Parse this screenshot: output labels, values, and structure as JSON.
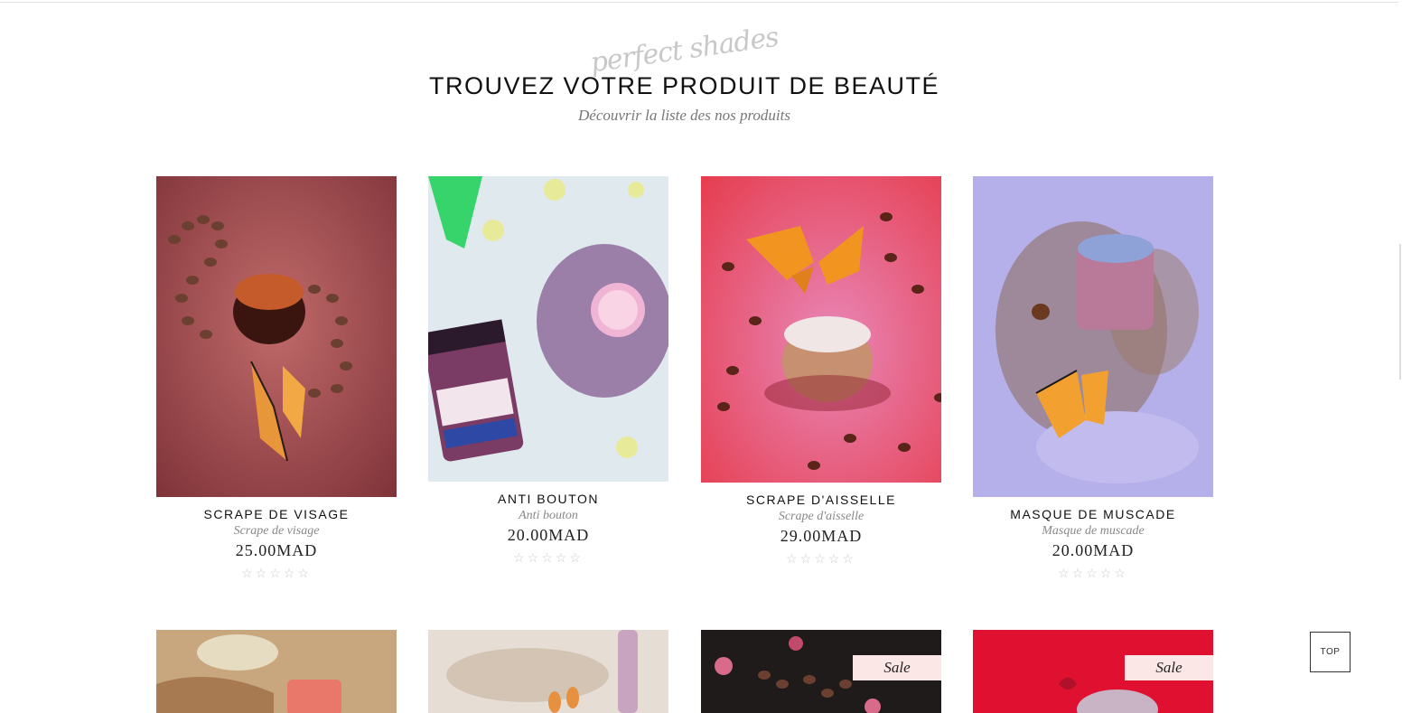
{
  "header": {
    "script": "perfect shades",
    "title": "TROUVEZ VOTRE PRODUIT DE BEAUTÉ",
    "subtitle": "Découvrir la liste des nos produits"
  },
  "products": [
    {
      "name": "SCRAPE DE VISAGE",
      "subtitle": "Scrape de visage",
      "price": "25.00MAD",
      "rating": "☆☆☆☆☆"
    },
    {
      "name": "ANTI BOUTON",
      "subtitle": "Anti bouton",
      "price": "20.00MAD",
      "rating": "☆☆☆☆☆"
    },
    {
      "name": "SCRAPE D'AISSELLE",
      "subtitle": "Scrape d'aisselle",
      "price": "29.00MAD",
      "rating": "☆☆☆☆☆"
    },
    {
      "name": "MASQUE DE MUSCADE",
      "subtitle": "Masque de muscade",
      "price": "20.00MAD",
      "rating": "☆☆☆☆☆"
    }
  ],
  "row2": [
    {
      "badge": ""
    },
    {
      "badge": ""
    },
    {
      "badge": "Sale"
    },
    {
      "badge": "Sale"
    }
  ],
  "top_button": "TOP",
  "colors": {
    "sale_badge": "#fbe7e5",
    "accent": "#111111"
  }
}
